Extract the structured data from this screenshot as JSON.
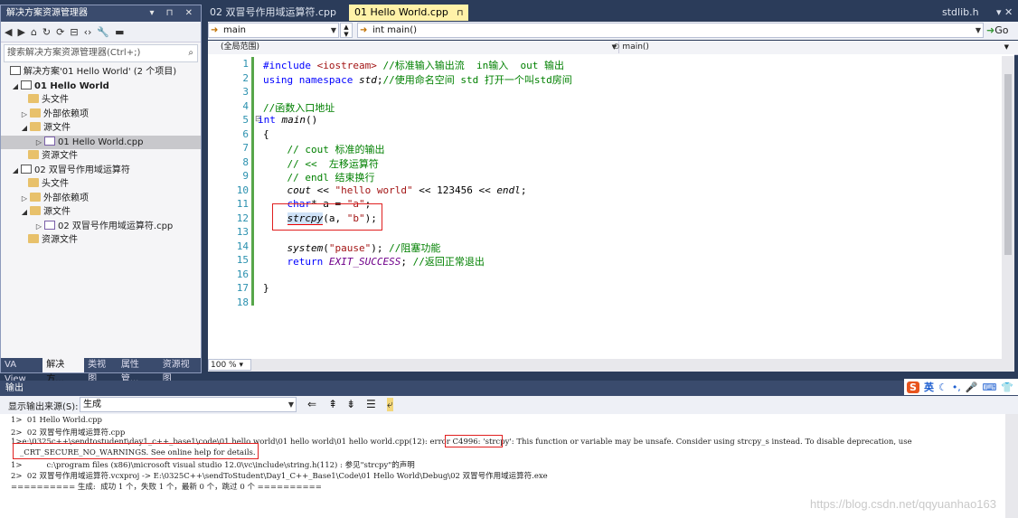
{
  "solution_explorer": {
    "title": "解决方案资源管理器",
    "title_buttons": "▾ ⊓ ✕",
    "search_placeholder": "搜索解决方案资源管理器(Ctrl+;)",
    "items": [
      {
        "label": "解决方案'01 Hello World' (2 个项目)"
      },
      {
        "label": "01 Hello World"
      },
      {
        "label": "头文件"
      },
      {
        "label": "外部依赖项"
      },
      {
        "label": "源文件"
      },
      {
        "label": "01 Hello World.cpp"
      },
      {
        "label": "资源文件"
      },
      {
        "label": "02 双冒号作用域运算符"
      },
      {
        "label": "头文件"
      },
      {
        "label": "外部依赖项"
      },
      {
        "label": "源文件"
      },
      {
        "label": "02 双冒号作用域运算符.cpp"
      },
      {
        "label": "资源文件"
      }
    ],
    "bottom_tabs": [
      "VA View",
      "解决方...",
      "类视图",
      "属性管...",
      "资源视图"
    ]
  },
  "editor": {
    "tabs": [
      "02 双冒号作用域运算符.cpp",
      "01 Hello World.cpp",
      "stdlib.h"
    ],
    "nav_left": "main",
    "nav_right": "int main()",
    "go_label": "Go",
    "scope_left": "(全局范围)",
    "scope_right": "main()",
    "zoom": "100 %",
    "line_numbers": [
      "1",
      "2",
      "3",
      "4",
      "5",
      "6",
      "7",
      "8",
      "9",
      "10",
      "11",
      "12",
      "13",
      "14",
      "15",
      "16",
      "17",
      "18"
    ]
  },
  "output": {
    "title": "输出",
    "source_label": "显示输出来源(S):",
    "source_value": "生成",
    "lines": [
      "1>  01 Hello World.cpp",
      "2>  02 双冒号作用域运算符.cpp",
      "1>e:\\0325c++\\sendtostudent\\day1_c++_base1\\code\\01 hello world\\01 hello world\\01 hello world.cpp(12):",
      "error C4996:",
      "'strcpy': This function or variable may be unsafe. Consider using strcpy_s instead. To disable deprecation, use",
      "_CRT_SECURE_NO_WARNINGS. See online help for details.",
      "1>          c:\\program files (x86)\\microsoft visual studio 12.0\\vc\\include\\string.h(112) : 参见\"strcpy\"的声明",
      "2>  02 双冒号作用域运算符.vcxproj -> E:\\0325C++\\sendToStudent\\Day1_C++_Base1\\Code\\01 Hello World\\Debug\\02 双冒号作用域运算符.exe",
      "========== 生成:  成功 1 个，失败 1 个，最新 0 个，跳过 0 个 =========="
    ],
    "watermark": "https://blog.csdn.net/qqyuanhao163"
  },
  "ime": {
    "label": "英"
  }
}
